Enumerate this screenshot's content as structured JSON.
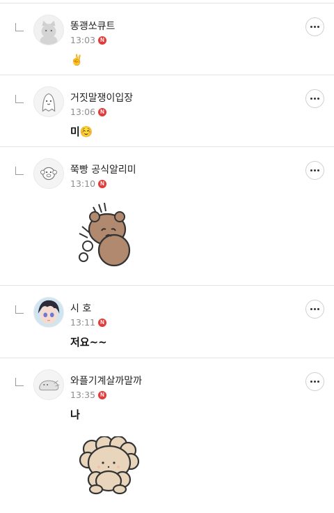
{
  "replies": [
    {
      "nickname": "똥괭쏘큐트",
      "time": "13:03",
      "badge": "N",
      "content": "✌️"
    },
    {
      "nickname": "거짓말쟁이입장",
      "time": "13:06",
      "badge": "N",
      "content": "미☺️"
    },
    {
      "nickname": "쭉빵 공식알리미",
      "time": "13:10",
      "badge": "N",
      "content": ""
    },
    {
      "nickname": "시 호",
      "time": "13:11",
      "badge": "N",
      "content": "저요~~"
    },
    {
      "nickname": "와플기계살까말까",
      "time": "13:35",
      "badge": "N",
      "content": "나"
    }
  ],
  "colors": {
    "badge_red": "#e23b3b",
    "divider": "#e4e4e4",
    "meta_gray": "#8e8e8e",
    "bear_brown": "#b0896e",
    "puppy_beige": "#e9d5bb"
  },
  "icons": {
    "reply": "reply-arrow-icon",
    "more": "more-options-icon",
    "sticker_3": "angry-bear-sticker",
    "sticker_5": "fluffy-puppy-sticker"
  }
}
